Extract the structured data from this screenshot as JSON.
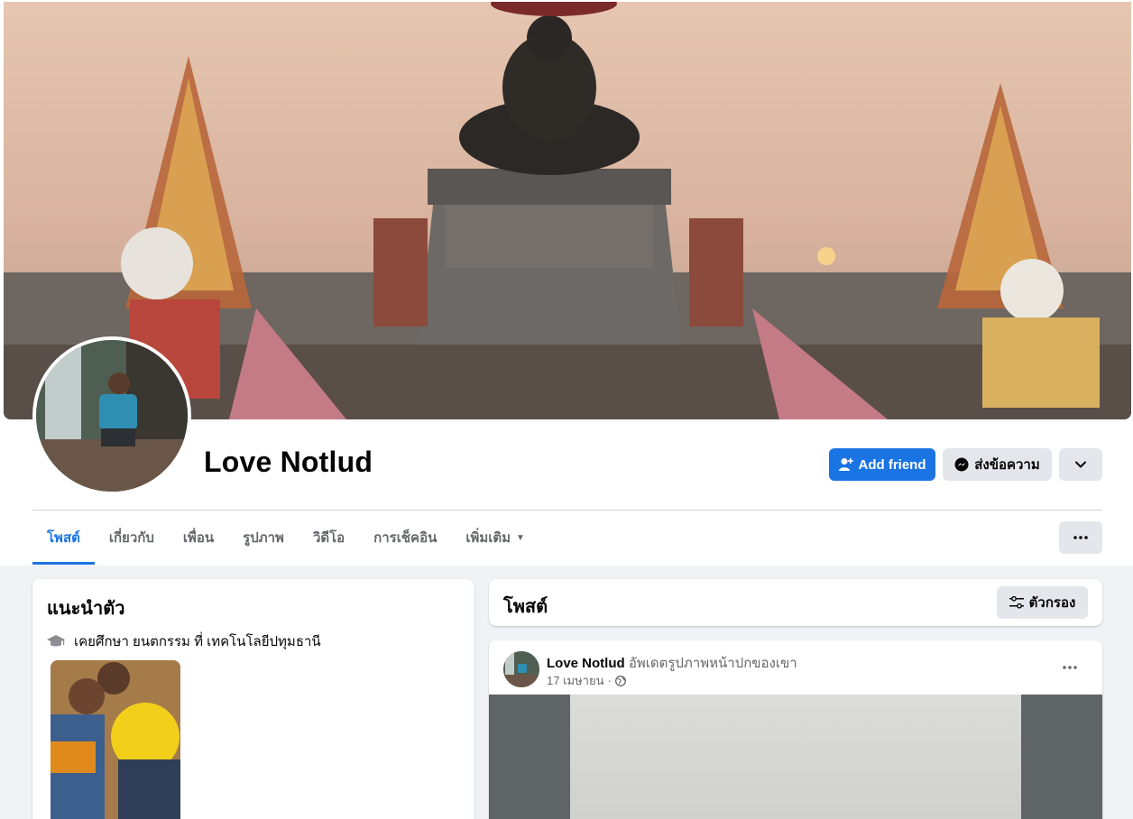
{
  "profile": {
    "name": "Love Notlud",
    "actions": {
      "add_friend": "Add friend",
      "message": "ส่งข้อความ"
    }
  },
  "tabs": [
    {
      "label": "โพสต์",
      "active": true
    },
    {
      "label": "เกี่ยวกับ"
    },
    {
      "label": "เพื่อน"
    },
    {
      "label": "รูปภาพ"
    },
    {
      "label": "วิดีโอ"
    },
    {
      "label": "การเช็คอิน"
    },
    {
      "label": "เพิ่มเติม",
      "dropdown": true
    }
  ],
  "intro": {
    "title": "แนะนำตัว",
    "education": "เคยศึกษา ยนตกรรม ที่ เทคโนโลยีปทุมธานี",
    "education_icon": "graduation-cap-icon"
  },
  "posts_section": {
    "title": "โพสต์",
    "filter_label": "ตัวกรอง"
  },
  "post": {
    "author": "Love Notlud",
    "action": "อัพเดตรูปภาพหน้าปกของเขา",
    "date": "17 เมษายน",
    "separator": "·",
    "privacy_icon": "globe-icon"
  },
  "colors": {
    "accent": "#1b74e4",
    "background": "#f0f2f5",
    "secondary_button": "#e4e6eb"
  }
}
